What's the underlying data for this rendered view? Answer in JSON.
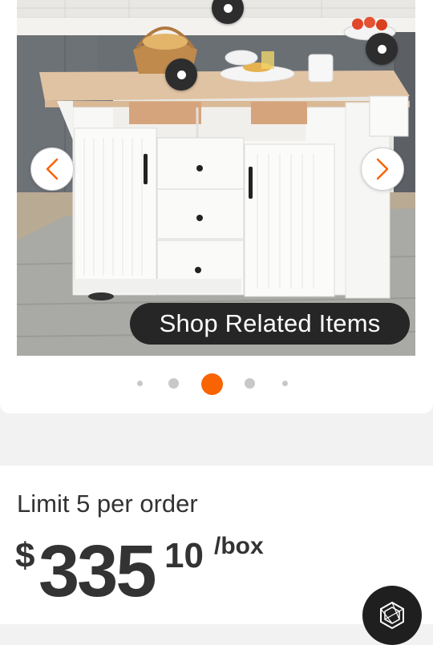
{
  "gallery": {
    "image_alt": "White kitchen island cart with drop-leaf wood top",
    "shop_related_label": "Shop Related Items",
    "pager": {
      "count": 5,
      "active_index": 2
    }
  },
  "purchase": {
    "limit_text": "Limit 5 per order",
    "price_currency": "$",
    "price_dollars": "335",
    "price_cents": "10",
    "price_unit": "/box"
  },
  "colors": {
    "accent": "#f96302",
    "dark": "#262626",
    "text": "#333333"
  }
}
